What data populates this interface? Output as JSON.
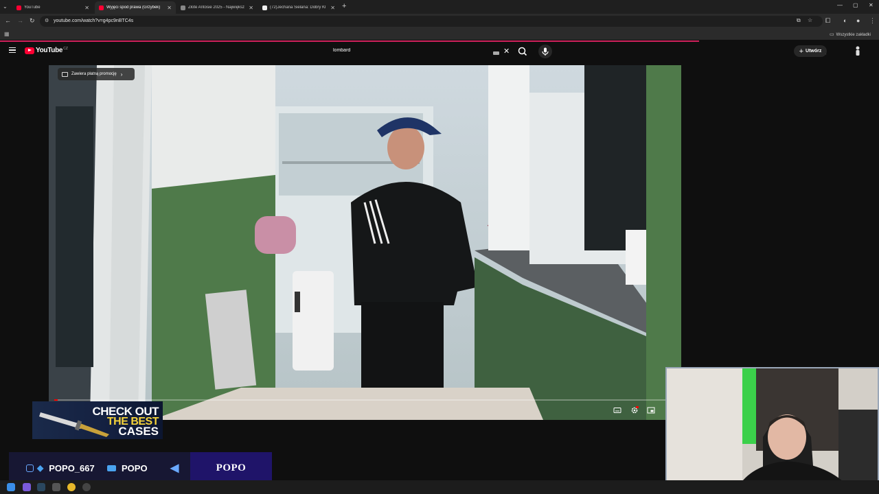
{
  "browser": {
    "tabs": [
      {
        "title": "YouTube",
        "active": false,
        "favicon_color": "#ff0033"
      },
      {
        "title": "Wyjęci spod prawa (Grzybek)",
        "active": true,
        "favicon_color": "#ff0033"
      },
      {
        "title": "Złote Antosie 2025 - Największ",
        "active": false,
        "favicon_color": "#888888"
      },
      {
        "title": "(72)Jechana Sielana: Dobry Kl",
        "active": false,
        "favicon_color": "#eeeeee"
      }
    ],
    "new_tab_icon": "plus-icon",
    "url": "youtube.com/watch?v=g4pc9nBTC4s",
    "bookmarks_label": "Wszystkie zakładki"
  },
  "youtube": {
    "logo_text": "YouTube",
    "country_code": "CZ",
    "search_value": "lombard",
    "create_label": "Utwórz",
    "accent": "#ff0033",
    "video": {
      "promo_label": "Zawiera płatną promocję",
      "progress_percent": 0.5
    }
  },
  "overlays": {
    "case_banner": {
      "line1": "CHECK OUT",
      "line2": "THE BEST",
      "line3": "CASES"
    },
    "social": {
      "twitter_handle": "POPO_667",
      "youtube_name": "POPO",
      "brand": "POPO"
    }
  }
}
